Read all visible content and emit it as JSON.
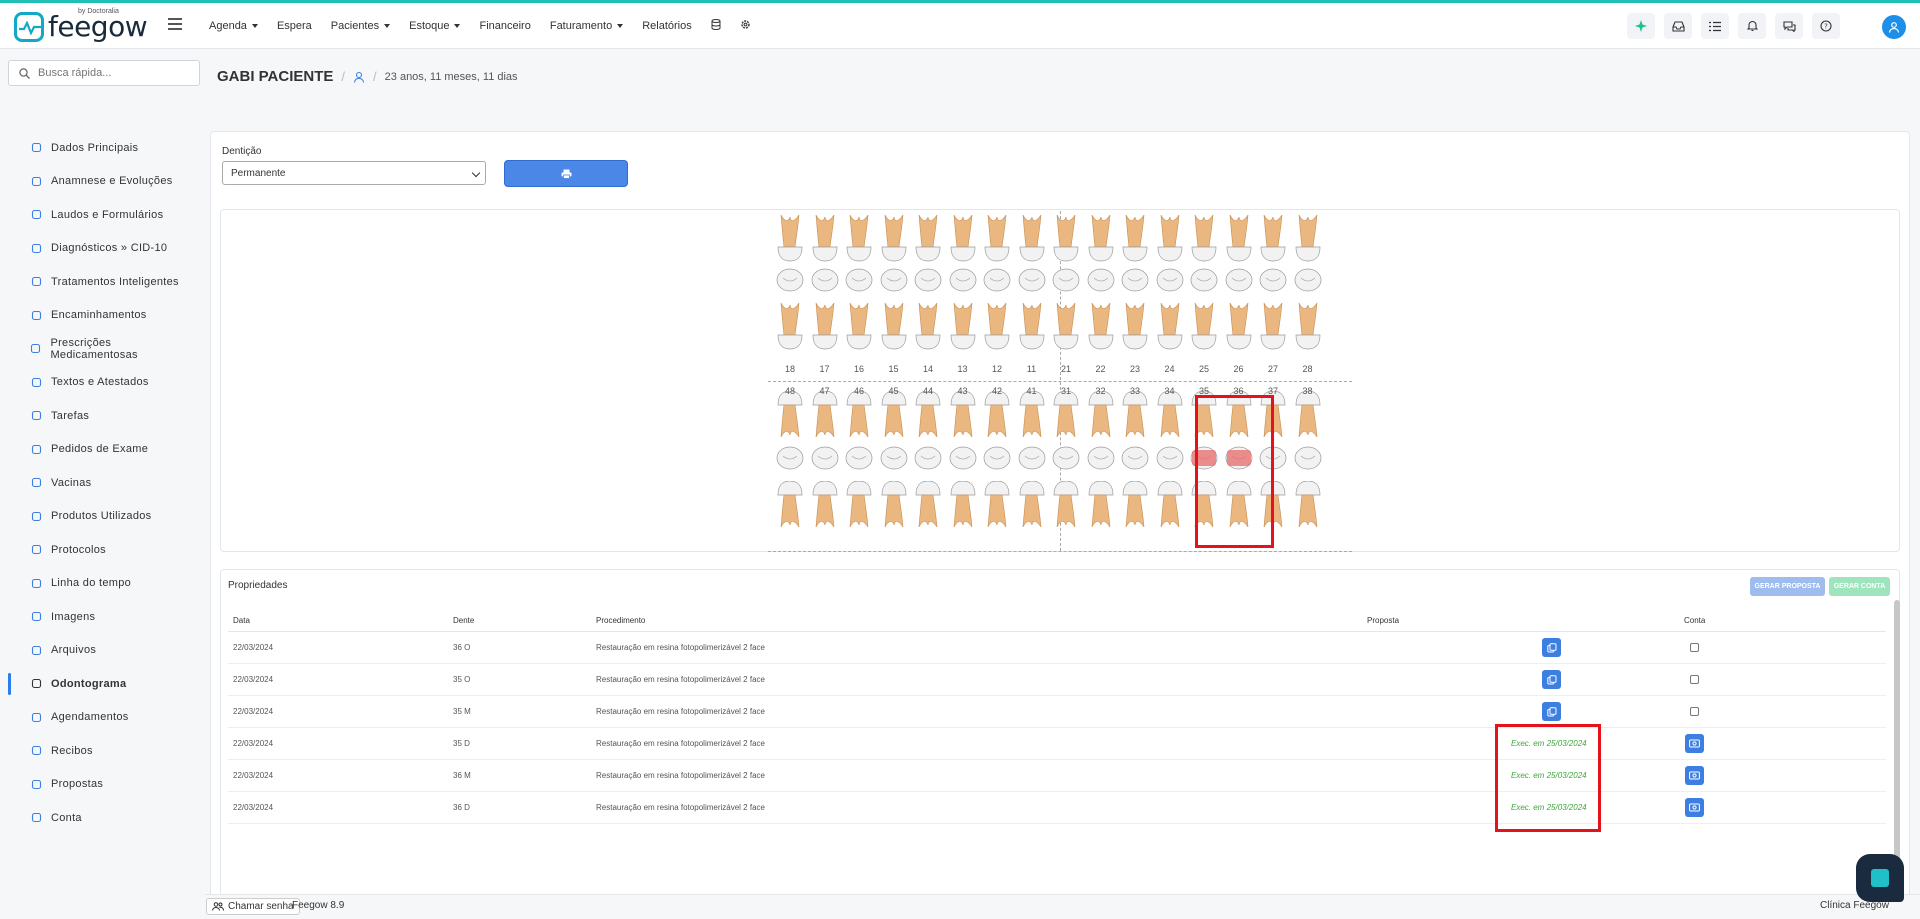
{
  "brand": {
    "name": "feegow",
    "sub": "by Doctoralia"
  },
  "menu": [
    {
      "label": "Agenda",
      "caret": true
    },
    {
      "label": "Espera",
      "caret": false
    },
    {
      "label": "Pacientes",
      "caret": true
    },
    {
      "label": "Estoque",
      "caret": true
    },
    {
      "label": "Financeiro",
      "caret": false
    },
    {
      "label": "Faturamento",
      "caret": true
    },
    {
      "label": "Relatórios",
      "caret": false
    }
  ],
  "search": {
    "placeholder": "Busca rápida..."
  },
  "sidebar": [
    {
      "label": "Dados Principais",
      "icon": "user-icon"
    },
    {
      "label": "Anamnese e Evoluções",
      "icon": "chart-line-icon"
    },
    {
      "label": "Laudos e Formulários",
      "icon": "clipboard-icon"
    },
    {
      "label": "Diagnósticos » CID-10",
      "icon": "stethoscope-icon"
    },
    {
      "label": "Tratamentos Inteligentes",
      "icon": "stethoscope-icon"
    },
    {
      "label": "Encaminhamentos",
      "icon": "file-icon"
    },
    {
      "label": "Prescrições Medicamentosas",
      "icon": "pills-icon"
    },
    {
      "label": "Textos e Atestados",
      "icon": "file-text-icon"
    },
    {
      "label": "Tarefas",
      "icon": "list-icon"
    },
    {
      "label": "Pedidos de Exame",
      "icon": "file-icon"
    },
    {
      "label": "Vacinas",
      "icon": "syringe-icon"
    },
    {
      "label": "Produtos Utilizados",
      "icon": "box-icon"
    },
    {
      "label": "Protocolos",
      "icon": "clipboard-icon"
    },
    {
      "label": "Linha do tempo",
      "icon": "chart-line-icon"
    },
    {
      "label": "Imagens",
      "icon": "camera-icon"
    },
    {
      "label": "Arquivos",
      "icon": "folder-icon"
    },
    {
      "label": "Odontograma",
      "icon": "globe-icon",
      "active": true
    },
    {
      "label": "Agendamentos",
      "icon": "calendar-icon"
    },
    {
      "label": "Recibos",
      "icon": "edit-icon"
    },
    {
      "label": "Propostas",
      "icon": "copy-icon"
    },
    {
      "label": "Conta",
      "icon": "money-icon"
    }
  ],
  "patient": {
    "name": "GABI PACIENTE",
    "age": "23 anos, 11 meses, 11 dias"
  },
  "denticao": {
    "label": "Dentição",
    "value": "Permanente"
  },
  "teeth": {
    "upper_numbers": [
      "18",
      "17",
      "16",
      "15",
      "14",
      "13",
      "12",
      "11",
      "21",
      "22",
      "23",
      "24",
      "25",
      "26",
      "27",
      "28"
    ],
    "lower_numbers": [
      "48",
      "47",
      "46",
      "45",
      "44",
      "43",
      "42",
      "41",
      "31",
      "32",
      "33",
      "34",
      "35",
      "36",
      "37",
      "38"
    ]
  },
  "props": {
    "title": "Propriedades",
    "btn_proposta": "GERAR PROPOSTA",
    "btn_conta": "GERAR CONTA",
    "headers": {
      "data": "Data",
      "dente": "Dente",
      "proc": "Procedimento",
      "prop": "Proposta",
      "conta": "Conta"
    },
    "rows": [
      {
        "data": "22/03/2024",
        "dente": "36 O",
        "proc": "Restauração em resina fotopolimerizável 2 face",
        "exec": ""
      },
      {
        "data": "22/03/2024",
        "dente": "35 O",
        "proc": "Restauração em resina fotopolimerizável 2 face",
        "exec": ""
      },
      {
        "data": "22/03/2024",
        "dente": "35 M",
        "proc": "Restauração em resina fotopolimerizável 2 face",
        "exec": ""
      },
      {
        "data": "22/03/2024",
        "dente": "35 D",
        "proc": "Restauração em resina fotopolimerizável 2 face",
        "exec": "Exec. em 25/03/2024"
      },
      {
        "data": "22/03/2024",
        "dente": "36 M",
        "proc": "Restauração em resina fotopolimerizável 2 face",
        "exec": "Exec. em 25/03/2024"
      },
      {
        "data": "22/03/2024",
        "dente": "36 D",
        "proc": "Restauração em resina fotopolimerizável 2 face",
        "exec": "Exec. em 25/03/2024"
      }
    ]
  },
  "footer": {
    "chamar": "Chamar senha",
    "version": "Feegow 8.9",
    "clinic": "Clínica Feegow"
  }
}
